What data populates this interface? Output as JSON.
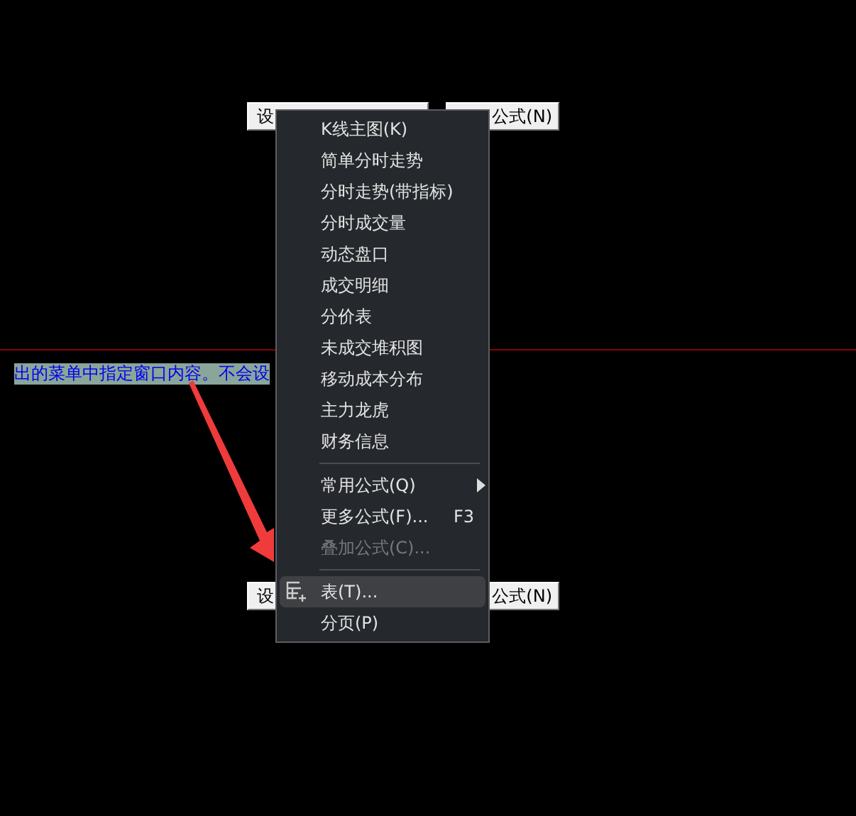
{
  "top_buttons": [
    {
      "label": "设"
    },
    {
      "label": "公式(N)"
    }
  ],
  "hint_text": "出的菜单中指定窗口内容。不会设",
  "bottom_buttons": [
    {
      "label": "设"
    },
    {
      "label": "公式(N)"
    }
  ],
  "context_menu": {
    "items": [
      {
        "kind": "item",
        "label": "K线主图(K)",
        "disabled": false,
        "selected": false
      },
      {
        "kind": "item",
        "label": "简单分时走势",
        "disabled": false,
        "selected": false
      },
      {
        "kind": "item",
        "label": "分时走势(带指标)",
        "disabled": false,
        "selected": false
      },
      {
        "kind": "item",
        "label": "分时成交量",
        "disabled": false,
        "selected": false
      },
      {
        "kind": "item",
        "label": "动态盘口",
        "disabled": false,
        "selected": false
      },
      {
        "kind": "item",
        "label": "成交明细",
        "disabled": false,
        "selected": false
      },
      {
        "kind": "item",
        "label": "分价表",
        "disabled": false,
        "selected": false
      },
      {
        "kind": "item",
        "label": "未成交堆积图",
        "disabled": false,
        "selected": false
      },
      {
        "kind": "item",
        "label": "移动成本分布",
        "disabled": false,
        "selected": false
      },
      {
        "kind": "item",
        "label": "主力龙虎",
        "disabled": false,
        "selected": false
      },
      {
        "kind": "item",
        "label": "财务信息",
        "disabled": false,
        "selected": false
      },
      {
        "kind": "separator"
      },
      {
        "kind": "submenu",
        "label": "常用公式(Q)",
        "disabled": false,
        "selected": false
      },
      {
        "kind": "item",
        "label": "更多公式(F)...",
        "shortcut": "F3",
        "disabled": false,
        "selected": false
      },
      {
        "kind": "item",
        "label": "叠加公式(C)...",
        "disabled": true,
        "selected": false
      },
      {
        "kind": "separator"
      },
      {
        "kind": "icon_item",
        "label": "表(T)...",
        "disabled": false,
        "selected": true
      },
      {
        "kind": "item",
        "label": "分页(P)",
        "disabled": false,
        "selected": false
      }
    ]
  }
}
